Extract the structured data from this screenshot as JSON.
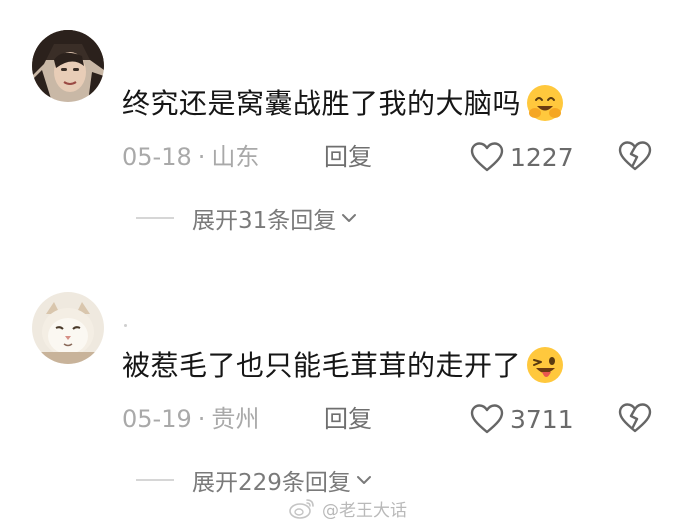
{
  "comments": [
    {
      "avatar": "avatar-person-icon",
      "text": "终究还是窝囊战胜了我的大脑吗",
      "emoji": "smiling-face-with-open-hands-emoji",
      "date": "05-18",
      "separator": "·",
      "location": "山东",
      "reply_label": "回复",
      "likes": "1227",
      "expand_label": "展开31条回复"
    },
    {
      "avatar": "avatar-cat-icon",
      "text": "被惹毛了也只能毛茸茸的走开了",
      "emoji": "winking-face-with-tongue-emoji",
      "date": "05-19",
      "separator": "·",
      "location": "贵州",
      "reply_label": "回复",
      "likes": "3711",
      "expand_label": "展开229条回复"
    }
  ],
  "watermark": {
    "text": "@老王大话",
    "icon": "weibo-icon"
  },
  "colors": {
    "text": "#161616",
    "meta": "#a9a9a9",
    "icon": "#6a6a6a",
    "emoji_yellow": "#ffc83d"
  }
}
